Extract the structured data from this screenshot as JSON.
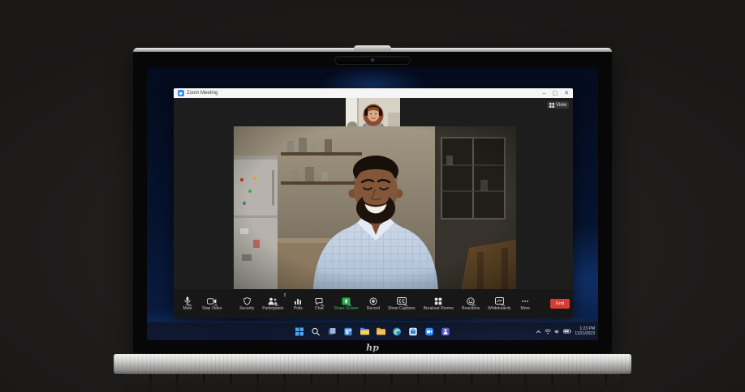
{
  "brand": {
    "logo_text": "hp"
  },
  "window": {
    "title": "Zoom Meeting",
    "controls": {
      "minimize": "–",
      "maximize": "▢",
      "close": "✕"
    },
    "view_button": {
      "label": "View"
    }
  },
  "meeting": {
    "toolbar": {
      "items": [
        {
          "label": "Mute",
          "icon": "microphone-icon",
          "caret": true
        },
        {
          "label": "Stop Video",
          "icon": "video-camera-icon",
          "caret": true
        },
        {
          "label": "Security",
          "icon": "shield-icon",
          "caret": false
        },
        {
          "label": "Participants",
          "icon": "participants-icon",
          "caret": true,
          "badge": "2"
        },
        {
          "label": "Polls",
          "icon": "polls-icon",
          "caret": false
        },
        {
          "label": "Chat",
          "icon": "chat-icon",
          "caret": true
        },
        {
          "label": "Share Screen",
          "icon": "share-screen-icon",
          "caret": true,
          "accent": "#27ae4e"
        },
        {
          "label": "Record",
          "icon": "record-icon",
          "caret": false
        },
        {
          "label": "Show Captions",
          "icon": "captions-icon",
          "caret": true
        },
        {
          "label": "Breakout Rooms",
          "icon": "breakout-rooms-icon",
          "caret": false
        },
        {
          "label": "Reactions",
          "icon": "reactions-icon",
          "caret": true
        },
        {
          "label": "Whiteboards",
          "icon": "whiteboard-icon",
          "caret": true
        },
        {
          "label": "More",
          "icon": "more-icon",
          "caret": false
        }
      ],
      "end_button": {
        "label": "End"
      }
    },
    "participants": {
      "main_video": "man-smiling-in-kitchen",
      "thumbnail_video": "woman-with-headphones"
    }
  },
  "taskbar": {
    "icons": [
      "start-icon",
      "search-icon",
      "task-view-icon",
      "widgets-icon",
      "file-explorer-icon",
      "edge-icon",
      "store-icon",
      "zoom-app-icon",
      "outlook-icon",
      "teams-icon"
    ],
    "tray": {
      "time": "1:23 PM",
      "date": "11/21/2023"
    }
  },
  "colors": {
    "zoom_blue": "#2d8cff",
    "share_green": "#27ae4e",
    "end_red": "#d83b31",
    "taskbar_bg": "rgba(15,21,37,0.86)",
    "wallpaper_blue": "#0a1d44"
  }
}
